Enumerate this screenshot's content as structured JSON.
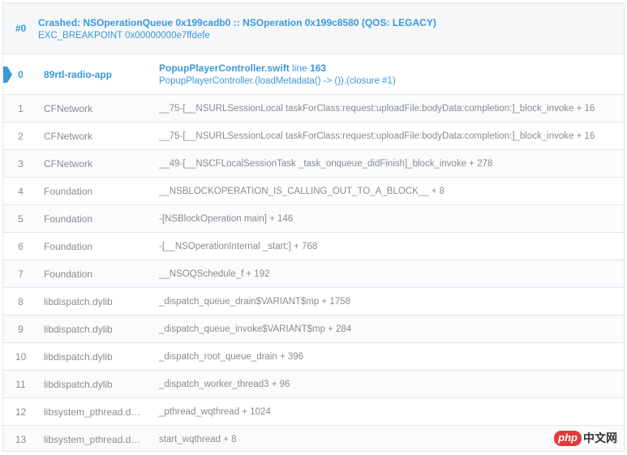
{
  "thread": {
    "index": "#0",
    "title": "Crashed: NSOperationQueue 0x199cadb0 :: NSOperation 0x199c8580 (QOS: LEGACY)",
    "exception": "EXC_BREAKPOINT 0x00000000e7ffdefe"
  },
  "crash_frame": {
    "num": "0",
    "library": "89rtl-radio-app",
    "file": "PopupPlayerController.swift",
    "line_label": "line",
    "line_number": "163",
    "method": "PopupPlayerController.(loadMetadata() -> ()).(closure #1)"
  },
  "frames": [
    {
      "num": "1",
      "library": "CFNetwork",
      "symbol": "__75-[__NSURLSessionLocal taskForClass:request:uploadFile:bodyData:completion:]_block_invoke + 16"
    },
    {
      "num": "2",
      "library": "CFNetwork",
      "symbol": "__75-[__NSURLSessionLocal taskForClass:request:uploadFile:bodyData:completion:]_block_invoke + 16"
    },
    {
      "num": "3",
      "library": "CFNetwork",
      "symbol": "__49-[__NSCFLocalSessionTask _task_onqueue_didFinish]_block_invoke + 278"
    },
    {
      "num": "4",
      "library": "Foundation",
      "symbol": "__NSBLOCKOPERATION_IS_CALLING_OUT_TO_A_BLOCK__ + 8"
    },
    {
      "num": "5",
      "library": "Foundation",
      "symbol": "-[NSBlockOperation main] + 146"
    },
    {
      "num": "6",
      "library": "Foundation",
      "symbol": "-[__NSOperationInternal _start:] + 768"
    },
    {
      "num": "7",
      "library": "Foundation",
      "symbol": "__NSOQSchedule_f + 192"
    },
    {
      "num": "8",
      "library": "libdispatch.dylib",
      "symbol": "_dispatch_queue_drain$VARIANT$mp + 1758"
    },
    {
      "num": "9",
      "library": "libdispatch.dylib",
      "symbol": "_dispatch_queue_invoke$VARIANT$mp + 284"
    },
    {
      "num": "10",
      "library": "libdispatch.dylib",
      "symbol": "_dispatch_root_queue_drain + 396"
    },
    {
      "num": "11",
      "library": "libdispatch.dylib",
      "symbol": "_dispatch_worker_thread3 + 96"
    },
    {
      "num": "12",
      "library": "libsystem_pthread.d…",
      "symbol": "_pthread_wqthread + 1024"
    },
    {
      "num": "13",
      "library": "libsystem_pthread.d…",
      "symbol": "start_wqthread + 8"
    }
  ],
  "watermark": {
    "badge": "php",
    "text": "中文网"
  },
  "colors": {
    "accent": "#3a99d8",
    "muted": "#888c90",
    "border": "#e2e6ea"
  }
}
